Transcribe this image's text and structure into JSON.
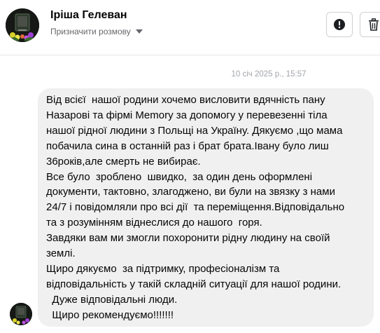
{
  "header": {
    "contact_name": "Іріша Гелеван",
    "assign_label": "Призначити розмову",
    "report_icon": "exclamation-circle-icon",
    "delete_icon": "trash-icon"
  },
  "conversation": {
    "timestamp": "10 січ 2025 р., 15:57",
    "message_lines": [
      "Від всієї  нашої родини хочемо висловити вдячність пану",
      "Назарові та фірмі Memory за допомогу у перевезенні тіла",
      "нашої рідної людини з Польщі на Україну. Дякуємо ,що мама",
      "побачила сина в останній раз і брат брата.Івану було лиш",
      "36років,але смерть не вибирає.",
      "Все було  зроблено  швидко,  за один день оформлені",
      "документи, тактовно, злагоджено, ви були на звязку з нами",
      "24/7 і повідомляли про всі дії  та переміщення.Відповідально",
      "та з розумінням віднеслися до нашого  горя.",
      "Завдяки вам ми змогли похоронити рідну людину на своїй",
      "землі.",
      "Щиро дякуємо  за підтримку, професіоналізм та",
      "відповідальність у такій складній ситуації для нашої родини.",
      "  Дуже відповідальні люди.",
      "  Щиро рекомендуємо!!!!!!!"
    ]
  },
  "colors": {
    "bubble_bg": "#f0f0f0",
    "text": "#050505",
    "secondary_text": "#65676b",
    "timestamp_text": "#a2a5aa",
    "border": "#ced0d4"
  }
}
